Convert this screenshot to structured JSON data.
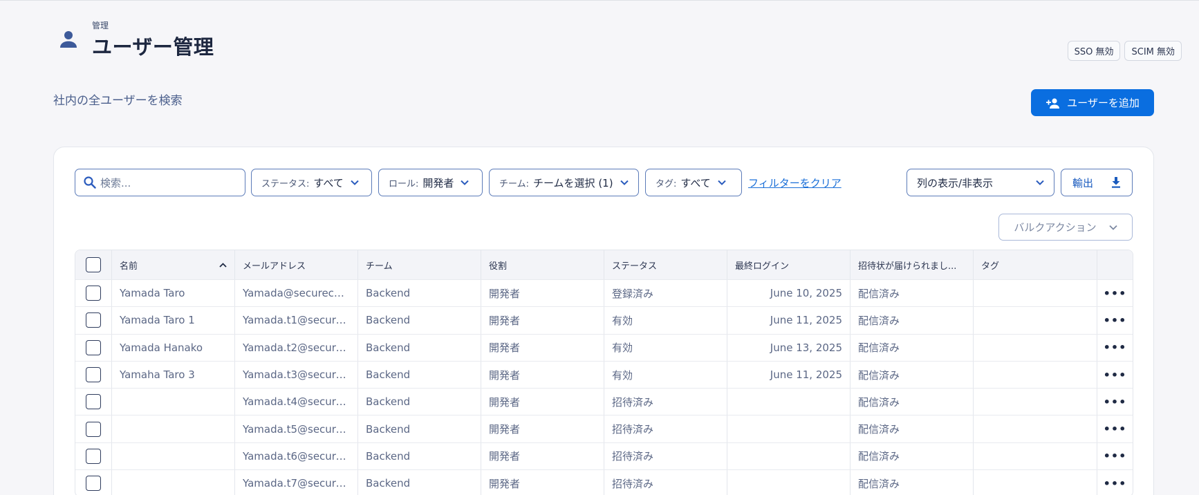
{
  "header": {
    "breadcrumb": "管理",
    "title": "ユーザー管理",
    "badges": [
      "SSO 無効",
      "SCIM 無効"
    ],
    "subtitle": "社内の全ユーザーを検索",
    "add_user_label": "ユーザーを追加"
  },
  "toolbar": {
    "search_placeholder": "検索...",
    "filters": [
      {
        "label": "ステータス:",
        "value": "すべて"
      },
      {
        "label": "ロール:",
        "value": "開発者"
      },
      {
        "label": "チーム:",
        "value": "チームを選択 (1)"
      },
      {
        "label": "タグ:",
        "value": "すべて"
      }
    ],
    "clear_filters": "フィルターをクリア",
    "columns_toggle": "列の表示/非表示",
    "export_label": "輸出",
    "bulk_actions": "バルクアクション"
  },
  "table": {
    "columns": [
      "名前",
      "メールアドレス",
      "チーム",
      "役割",
      "ステータス",
      "最終ログイン",
      "招待状が届けられまし...",
      "タグ"
    ],
    "rows": [
      {
        "name": "Yamada Taro",
        "email": "Yamada@secureco...",
        "team": "Backend",
        "role": "開発者",
        "status": "登録済み",
        "last_login": "June 10, 2025",
        "invite": "配信済み",
        "tag": ""
      },
      {
        "name": "Yamada Taro 1",
        "email": "Yamada.t1@securec...",
        "team": "Backend",
        "role": "開発者",
        "status": "有効",
        "last_login": "June 11, 2025",
        "invite": "配信済み",
        "tag": ""
      },
      {
        "name": "Yamada Hanako",
        "email": "Yamada.t2@secure...",
        "team": "Backend",
        "role": "開発者",
        "status": "有効",
        "last_login": "June 13, 2025",
        "invite": "配信済み",
        "tag": ""
      },
      {
        "name": "Yamaha Taro 3",
        "email": "Yamada.t3@secure...",
        "team": "Backend",
        "role": "開発者",
        "status": "有効",
        "last_login": "June 11, 2025",
        "invite": "配信済み",
        "tag": ""
      },
      {
        "name": "",
        "email": "Yamada.t4@secure...",
        "team": "Backend",
        "role": "開発者",
        "status": "招待済み",
        "last_login": "",
        "invite": "配信済み",
        "tag": ""
      },
      {
        "name": "",
        "email": "Yamada.t5@secure...",
        "team": "Backend",
        "role": "開発者",
        "status": "招待済み",
        "last_login": "",
        "invite": "配信済み",
        "tag": ""
      },
      {
        "name": "",
        "email": "Yamada.t6@secure...",
        "team": "Backend",
        "role": "開発者",
        "status": "招待済み",
        "last_login": "",
        "invite": "配信済み",
        "tag": ""
      },
      {
        "name": "",
        "email": "Yamada.t7@secure...",
        "team": "Backend",
        "role": "開発者",
        "status": "招待済み",
        "last_login": "",
        "invite": "配信済み",
        "tag": ""
      }
    ],
    "row_menu": "•••"
  },
  "colors": {
    "primary": "#0a6ee0",
    "link": "#1a6fd8",
    "background": "#f6f6f9"
  }
}
